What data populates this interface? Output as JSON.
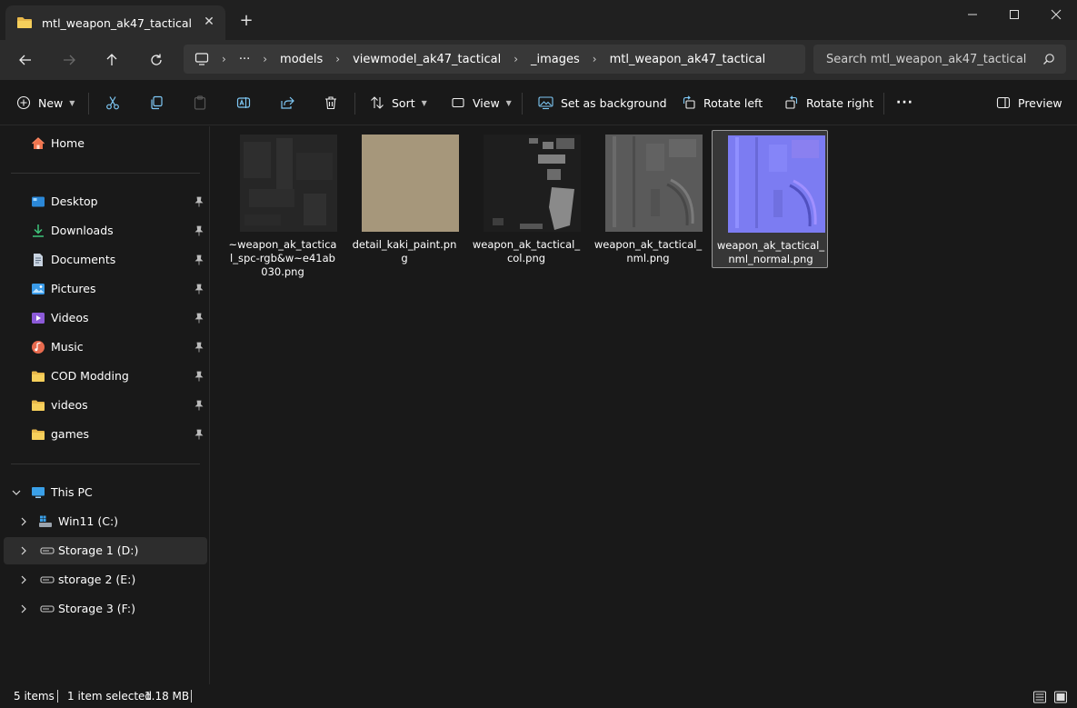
{
  "window": {
    "tab_title": "mtl_weapon_ak47_tactical",
    "new_tab_label": "+",
    "close_tab_label": "✕"
  },
  "address": {
    "overflow": "···",
    "crumbs": [
      "models",
      "viewmodel_ak47_tactical",
      "_images",
      "mtl_weapon_ak47_tactical"
    ]
  },
  "search": {
    "placeholder": "Search mtl_weapon_ak47_tactical"
  },
  "toolbar": {
    "new_label": "New",
    "sort_label": "Sort",
    "view_label": "View",
    "set_bg_label": "Set as background",
    "rotate_left_label": "Rotate left",
    "rotate_right_label": "Rotate right",
    "more_label": "···",
    "preview_label": "Preview"
  },
  "sidebar": {
    "home": "Home",
    "quick_access": [
      {
        "label": "Desktop",
        "icon": "desktop-icon"
      },
      {
        "label": "Downloads",
        "icon": "downloads-icon"
      },
      {
        "label": "Documents",
        "icon": "documents-icon"
      },
      {
        "label": "Pictures",
        "icon": "pictures-icon"
      },
      {
        "label": "Videos",
        "icon": "videos-icon"
      },
      {
        "label": "Music",
        "icon": "music-icon"
      },
      {
        "label": "COD Modding",
        "icon": "folder-icon"
      },
      {
        "label": "videos",
        "icon": "folder-icon"
      },
      {
        "label": "games",
        "icon": "folder-icon"
      }
    ],
    "this_pc": "This PC",
    "drives": [
      {
        "label": "Win11 (C:)"
      },
      {
        "label": "Storage 1 (D:)",
        "selected": true
      },
      {
        "label": "storage 2 (E:)"
      },
      {
        "label": "Storage 3 (F:)"
      }
    ]
  },
  "files": [
    {
      "name": "~weapon_ak_tactical_spc-rgb&w~e41ab030.png",
      "selected": false
    },
    {
      "name": "detail_kaki_paint.png",
      "selected": false
    },
    {
      "name": "weapon_ak_tactical_col.png",
      "selected": false
    },
    {
      "name": "weapon_ak_tactical_nml.png",
      "selected": false
    },
    {
      "name": "weapon_ak_tactical_nml_normal.png",
      "selected": true
    }
  ],
  "status": {
    "items_count": "5 items",
    "selection": "1 item selected",
    "size": "1.18 MB"
  },
  "colors": {
    "folder": "#f2c94c",
    "kaki": "#a6977b",
    "normal_map": "#7c7cf2",
    "accent": "#4cc2ff"
  }
}
